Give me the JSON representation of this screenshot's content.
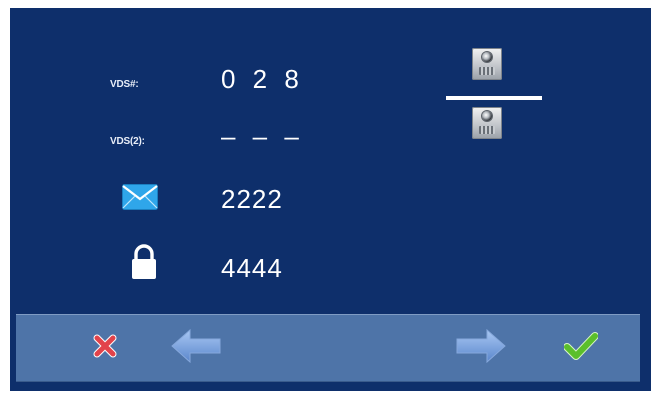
{
  "rows": {
    "vds": {
      "label": "VDS#:",
      "value": "0 2 8"
    },
    "vds2": {
      "label": "VDS(2):",
      "value": "– – –"
    },
    "mail": {
      "icon": "envelope-icon",
      "value": "2222"
    },
    "lock": {
      "icon": "padlock-icon",
      "value": "4444"
    }
  },
  "camera_panel": {
    "icons": [
      "door-camera-icon",
      "door-camera-icon"
    ]
  },
  "toolbar": {
    "buttons": [
      "cancel-x-icon",
      "arrow-left-icon",
      "arrow-right-icon",
      "confirm-check-icon"
    ]
  },
  "colors": {
    "screen_bg": "#0e2f6b",
    "toolbar_bg": "#4e74a8",
    "accent_red": "#e2434b",
    "accent_green": "#5bbf2b",
    "arrow_blue": "#6f9de0"
  }
}
